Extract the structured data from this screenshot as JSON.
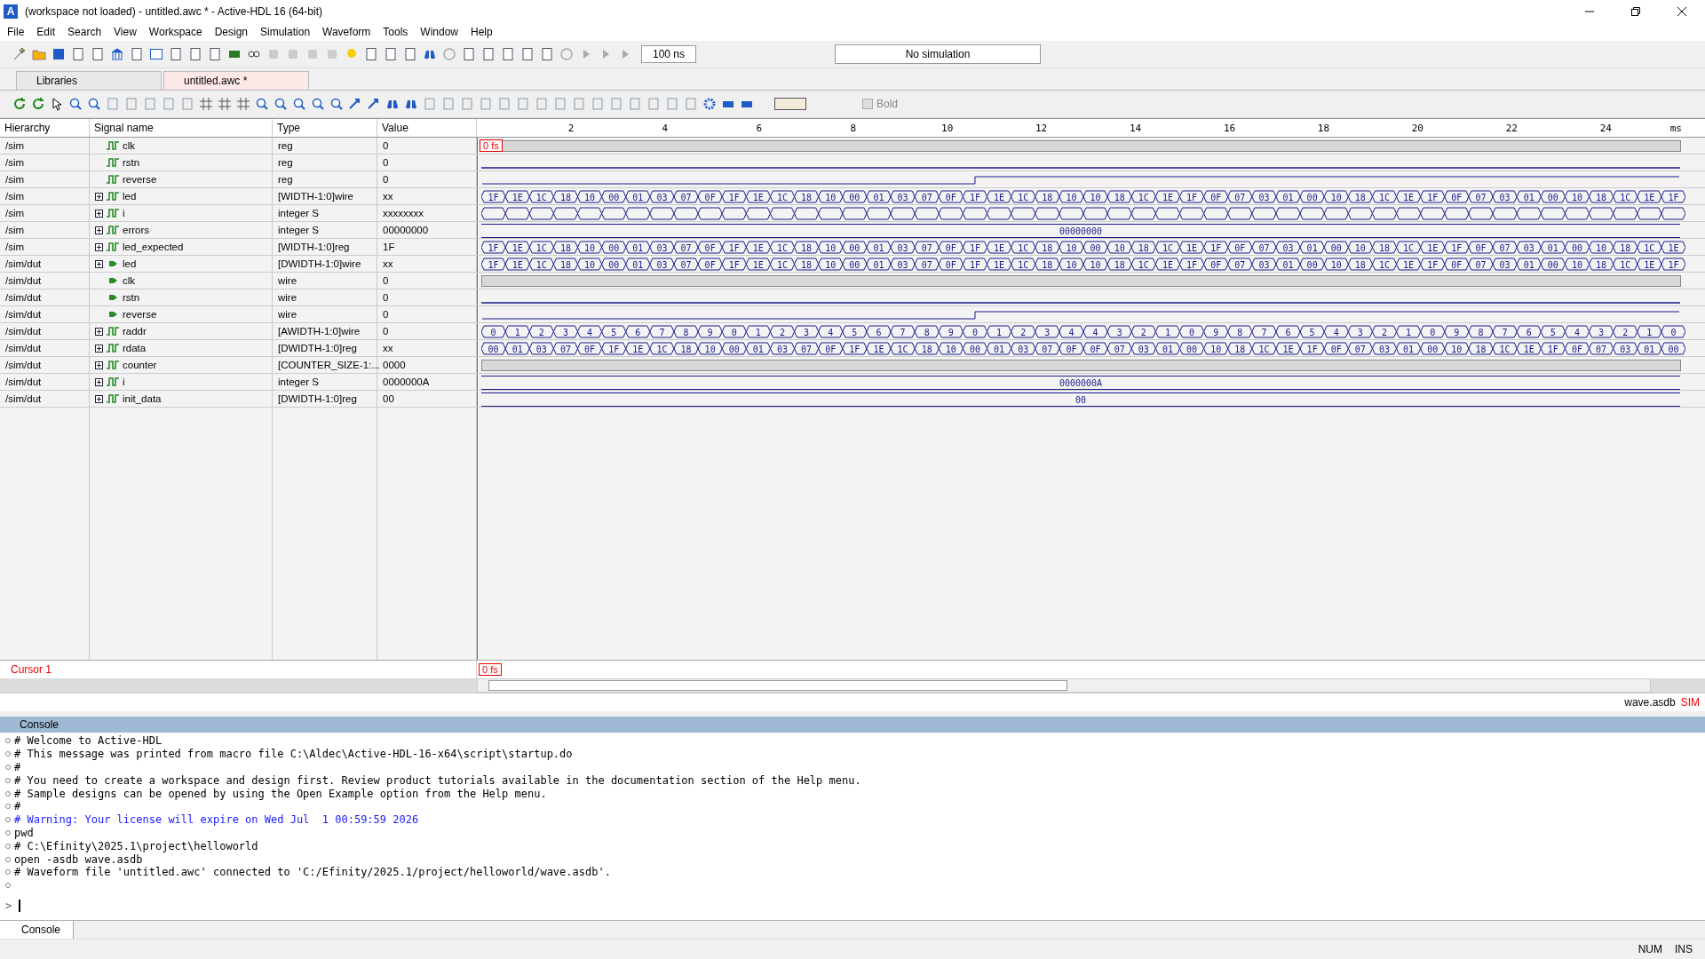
{
  "window": {
    "logo": "A",
    "title": "(workspace not loaded) - untitled.awc * - Active-HDL 16 (64-bit)"
  },
  "menu": [
    "File",
    "Edit",
    "Search",
    "View",
    "Workspace",
    "Design",
    "Simulation",
    "Waveform",
    "Tools",
    "Window",
    "Help"
  ],
  "toolbar": {
    "run_time": "100 ns",
    "status": "No simulation"
  },
  "tabs": [
    {
      "label": "Libraries",
      "selected": false
    },
    {
      "label": "untitled.awc *",
      "selected": true
    }
  ],
  "wave_toolbar": {
    "bold": {
      "label": "Bold",
      "checked": false,
      "disabled": true
    }
  },
  "columns": [
    "Hierarchy",
    "Signal name",
    "Type",
    "Value"
  ],
  "ruler": {
    "ticks": [
      "2",
      "4",
      "6",
      "8",
      "10",
      "12",
      "14",
      "16",
      "18",
      "20",
      "22",
      "24"
    ],
    "unit": "ms"
  },
  "cursor": {
    "label": "0 fs",
    "name": "Cursor 1",
    "time": "0 fs"
  },
  "signals": [
    {
      "hierarchy": "/sim",
      "name": "clk",
      "kind": "reg",
      "expandable": false,
      "type": "reg",
      "value": "0",
      "wave": {
        "kind": "dense"
      }
    },
    {
      "hierarchy": "/sim",
      "name": "rstn",
      "kind": "reg",
      "expandable": false,
      "type": "reg",
      "value": "0",
      "wave": {
        "kind": "low"
      }
    },
    {
      "hierarchy": "/sim",
      "name": "reverse",
      "kind": "reg",
      "expandable": false,
      "type": "reg",
      "value": "0",
      "wave": {
        "kind": "step"
      }
    },
    {
      "hierarchy": "/sim",
      "name": "led",
      "kind": "reg",
      "expandable": true,
      "type": "[WIDTH-1:0]wire",
      "value": "xx",
      "wave": {
        "kind": "bus",
        "values": [
          "1F",
          "1E",
          "1C",
          "18",
          "10",
          "00",
          "01",
          "03",
          "07",
          "0F",
          "1F",
          "1E",
          "1C",
          "18",
          "10",
          "00",
          "01",
          "03",
          "07",
          "0F",
          "1F",
          "1E",
          "1C",
          "18",
          "10",
          "10",
          "18",
          "1C",
          "1E",
          "1F",
          "0F",
          "07",
          "03",
          "01",
          "00",
          "10",
          "18",
          "1C",
          "1E",
          "1F",
          "0F",
          "07",
          "03",
          "01",
          "00",
          "10",
          "18",
          "1C",
          "1E",
          "1F"
        ]
      }
    },
    {
      "hierarchy": "/sim",
      "name": "i",
      "kind": "reg",
      "expandable": true,
      "type": "integer S",
      "value": "xxxxxxxx",
      "wave": {
        "kind": "bus_unknown"
      }
    },
    {
      "hierarchy": "/sim",
      "name": "errors",
      "kind": "reg",
      "expandable": true,
      "type": "integer S",
      "value": "00000000",
      "wave": {
        "kind": "const",
        "value": "00000000"
      }
    },
    {
      "hierarchy": "/sim",
      "name": "led_expected",
      "kind": "reg",
      "expandable": true,
      "type": "[WIDTH-1:0]reg",
      "value": "1F",
      "wave": {
        "kind": "bus",
        "values": [
          "1F",
          "1E",
          "1C",
          "18",
          "10",
          "00",
          "01",
          "03",
          "07",
          "0F",
          "1F",
          "1E",
          "1C",
          "18",
          "10",
          "00",
          "01",
          "03",
          "07",
          "0F",
          "1F",
          "1E",
          "1C",
          "18",
          "10",
          "00",
          "10",
          "18",
          "1C",
          "1E",
          "1F",
          "0F",
          "07",
          "03",
          "01",
          "00",
          "10",
          "18",
          "1C",
          "1E",
          "1F",
          "0F",
          "07",
          "03",
          "01",
          "00",
          "10",
          "18",
          "1C",
          "1E"
        ]
      }
    },
    {
      "hierarchy": "/sim/dut",
      "name": "led",
      "kind": "port",
      "expandable": true,
      "type": "[DWIDTH-1:0]wire",
      "value": "xx",
      "wave": {
        "kind": "bus",
        "values": [
          "1F",
          "1E",
          "1C",
          "18",
          "10",
          "00",
          "01",
          "03",
          "07",
          "0F",
          "1F",
          "1E",
          "1C",
          "18",
          "10",
          "00",
          "01",
          "03",
          "07",
          "0F",
          "1F",
          "1E",
          "1C",
          "18",
          "10",
          "10",
          "18",
          "1C",
          "1E",
          "1F",
          "0F",
          "07",
          "03",
          "01",
          "00",
          "10",
          "18",
          "1C",
          "1E",
          "1F",
          "0F",
          "07",
          "03",
          "01",
          "00",
          "10",
          "18",
          "1C",
          "1E",
          "1F"
        ]
      }
    },
    {
      "hierarchy": "/sim/dut",
      "name": "clk",
      "kind": "port",
      "expandable": false,
      "type": "wire",
      "value": "0",
      "wave": {
        "kind": "dense"
      }
    },
    {
      "hierarchy": "/sim/dut",
      "name": "rstn",
      "kind": "port",
      "expandable": false,
      "type": "wire",
      "value": "0",
      "wave": {
        "kind": "low"
      }
    },
    {
      "hierarchy": "/sim/dut",
      "name": "reverse",
      "kind": "port",
      "expandable": false,
      "type": "wire",
      "value": "0",
      "wave": {
        "kind": "step"
      }
    },
    {
      "hierarchy": "/sim/dut",
      "name": "raddr",
      "kind": "reg",
      "expandable": true,
      "type": "[AWIDTH-1:0]wire",
      "value": "0",
      "wave": {
        "kind": "bus",
        "values": [
          "0",
          "1",
          "2",
          "3",
          "4",
          "5",
          "6",
          "7",
          "8",
          "9",
          "0",
          "1",
          "2",
          "3",
          "4",
          "5",
          "6",
          "7",
          "8",
          "9",
          "0",
          "1",
          "2",
          "3",
          "4",
          "4",
          "3",
          "2",
          "1",
          "0",
          "9",
          "8",
          "7",
          "6",
          "5",
          "4",
          "3",
          "2",
          "1",
          "0",
          "9",
          "8",
          "7",
          "6",
          "5",
          "4",
          "3",
          "2",
          "1",
          "0"
        ]
      }
    },
    {
      "hierarchy": "/sim/dut",
      "name": "rdata",
      "kind": "reg",
      "expandable": true,
      "type": "[DWIDTH-1:0]reg",
      "value": "xx",
      "wave": {
        "kind": "bus",
        "values": [
          "00",
          "01",
          "03",
          "07",
          "0F",
          "1F",
          "1E",
          "1C",
          "18",
          "10",
          "00",
          "01",
          "03",
          "07",
          "0F",
          "1F",
          "1E",
          "1C",
          "18",
          "10",
          "00",
          "01",
          "03",
          "07",
          "0F",
          "0F",
          "07",
          "03",
          "01",
          "00",
          "10",
          "18",
          "1C",
          "1E",
          "1F",
          "0F",
          "07",
          "03",
          "01",
          "00",
          "10",
          "18",
          "1C",
          "1E",
          "1F",
          "0F",
          "07",
          "03",
          "01",
          "00"
        ]
      }
    },
    {
      "hierarchy": "/sim/dut",
      "name": "counter",
      "kind": "reg",
      "expandable": true,
      "type": "[COUNTER_SIZE-1:...",
      "value": "0000",
      "wave": {
        "kind": "dense"
      }
    },
    {
      "hierarchy": "/sim/dut",
      "name": "i",
      "kind": "reg",
      "expandable": true,
      "type": "integer S",
      "value": "0000000A",
      "wave": {
        "kind": "const",
        "value": "0000000A"
      }
    },
    {
      "hierarchy": "/sim/dut",
      "name": "init_data",
      "kind": "reg",
      "expandable": true,
      "type": "[DWIDTH-1:0]reg",
      "value": "00",
      "wave": {
        "kind": "const",
        "value": "00"
      }
    }
  ],
  "wave_status": {
    "file": "wave.asdb",
    "mode": "SIM"
  },
  "console": {
    "title": "Console",
    "lines": [
      {
        "kind": "comment",
        "text": "# Welcome to Active-HDL"
      },
      {
        "kind": "comment",
        "text": "# This message was printed from macro file C:\\Aldec\\Active-HDL-16-x64\\script\\startup.do"
      },
      {
        "kind": "comment",
        "text": "#"
      },
      {
        "kind": "comment",
        "text": "# You need to create a workspace and design first. Review product tutorials available in the documentation section of the Help menu."
      },
      {
        "kind": "comment",
        "text": "# Sample designs can be opened by using the Open Example option from the Help menu."
      },
      {
        "kind": "comment",
        "text": "#"
      },
      {
        "kind": "warning",
        "text": "# Warning: Your license will expire on Wed Jul  1 00:59:59 2026"
      },
      {
        "kind": "command",
        "text": "pwd"
      },
      {
        "kind": "comment",
        "text": "# C:\\Efinity\\2025.1\\project\\helloworld"
      },
      {
        "kind": "command",
        "text": "open -asdb wave.asdb"
      },
      {
        "kind": "comment",
        "text": "# Waveform file 'untitled.awc' connected to 'C:/Efinity/2025.1/project/helloworld/wave.asdb'."
      },
      {
        "kind": "blank"
      }
    ],
    "prompt": ">",
    "tab": "Console"
  },
  "status_bar": [
    "NUM",
    "INS"
  ]
}
